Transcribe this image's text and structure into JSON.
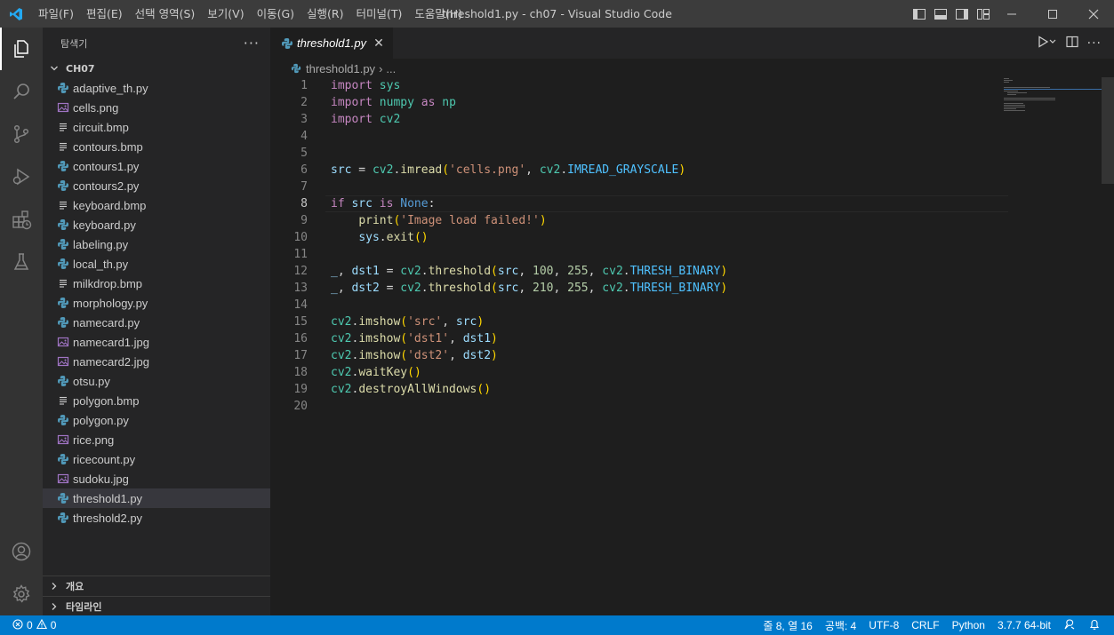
{
  "window": {
    "title": "threshold1.py - ch07 - Visual Studio Code",
    "menu": [
      "파일(F)",
      "편집(E)",
      "선택 영역(S)",
      "보기(V)",
      "이동(G)",
      "실행(R)",
      "터미널(T)",
      "도움말(H)"
    ]
  },
  "sidebar": {
    "title": "탐색기",
    "more": "···",
    "folder": "CH07",
    "files": [
      {
        "name": "adaptive_th.py",
        "type": "python"
      },
      {
        "name": "cells.png",
        "type": "image"
      },
      {
        "name": "circuit.bmp",
        "type": "bmp"
      },
      {
        "name": "contours.bmp",
        "type": "bmp"
      },
      {
        "name": "contours1.py",
        "type": "python"
      },
      {
        "name": "contours2.py",
        "type": "python"
      },
      {
        "name": "keyboard.bmp",
        "type": "bmp"
      },
      {
        "name": "keyboard.py",
        "type": "python"
      },
      {
        "name": "labeling.py",
        "type": "python"
      },
      {
        "name": "local_th.py",
        "type": "python"
      },
      {
        "name": "milkdrop.bmp",
        "type": "bmp"
      },
      {
        "name": "morphology.py",
        "type": "python"
      },
      {
        "name": "namecard.py",
        "type": "python"
      },
      {
        "name": "namecard1.jpg",
        "type": "image"
      },
      {
        "name": "namecard2.jpg",
        "type": "image"
      },
      {
        "name": "otsu.py",
        "type": "python"
      },
      {
        "name": "polygon.bmp",
        "type": "bmp"
      },
      {
        "name": "polygon.py",
        "type": "python"
      },
      {
        "name": "rice.png",
        "type": "image"
      },
      {
        "name": "ricecount.py",
        "type": "python"
      },
      {
        "name": "sudoku.jpg",
        "type": "image"
      },
      {
        "name": "threshold1.py",
        "type": "python",
        "selected": true
      },
      {
        "name": "threshold2.py",
        "type": "python"
      }
    ],
    "sections": [
      "개요",
      "타임라인"
    ]
  },
  "editor": {
    "tab_label": "threshold1.py",
    "breadcrumb": {
      "file": "threshold1.py",
      "sep": "›",
      "more": "..."
    },
    "current_line": 8,
    "line_numbers": [
      "1",
      "2",
      "3",
      "4",
      "5",
      "6",
      "7",
      "8",
      "9",
      "10",
      "11",
      "12",
      "13",
      "14",
      "15",
      "16",
      "17",
      "18",
      "19",
      "20"
    ],
    "code_lines": [
      "import sys",
      "import numpy as np",
      "import cv2",
      "",
      "",
      "src = cv2.imread('cells.png', cv2.IMREAD_GRAYSCALE)",
      "",
      "if src is None:",
      "    print('Image load failed!')",
      "    sys.exit()",
      "",
      "_, dst1 = cv2.threshold(src, 100, 255, cv2.THRESH_BINARY)",
      "_, dst2 = cv2.threshold(src, 210, 255, cv2.THRESH_BINARY)",
      "",
      "cv2.imshow('src', src)",
      "cv2.imshow('dst1', dst1)",
      "cv2.imshow('dst2', dst2)",
      "cv2.waitKey()",
      "cv2.destroyAllWindows()",
      ""
    ]
  },
  "statusbar": {
    "errors": "0",
    "warnings": "0",
    "position": "줄 8, 열 16",
    "indent": "공백: 4",
    "encoding": "UTF-8",
    "eol": "CRLF",
    "language": "Python",
    "interpreter": "3.7.7 64-bit"
  },
  "colors": {
    "titlebar": "#3c3c3c",
    "activitybar": "#333333",
    "sidebar": "#252526",
    "editor": "#1e1e1e",
    "statusbar": "#007acc",
    "accent": "#007acc"
  },
  "icons": {
    "activity": [
      "explorer-icon",
      "search-icon",
      "source-control-icon",
      "run-debug-icon",
      "extensions-icon",
      "testing-icon",
      "account-icon",
      "settings-gear-icon"
    ]
  }
}
